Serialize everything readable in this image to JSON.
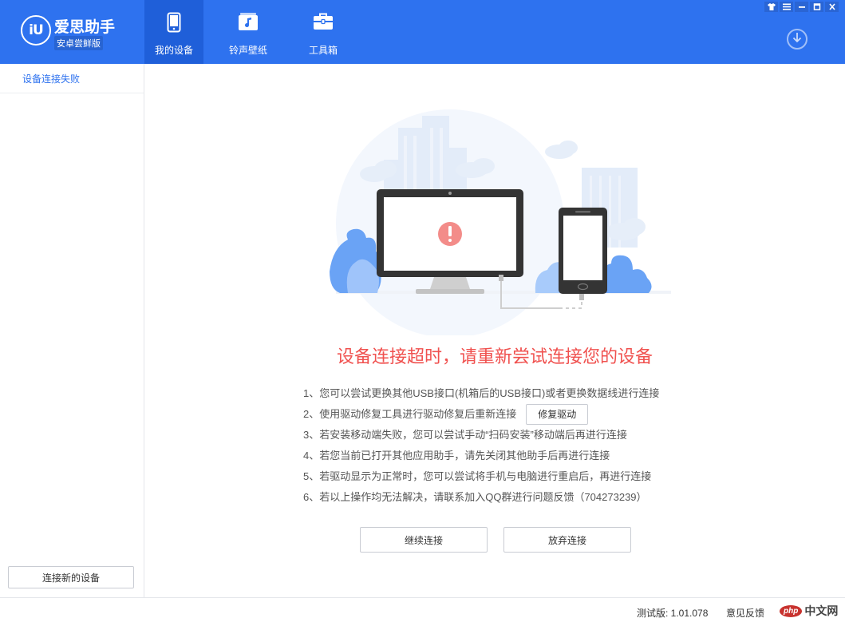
{
  "app": {
    "logo_mark": "iU",
    "name": "爱思助手",
    "edition": "安卓尝鲜版"
  },
  "nav": {
    "tabs": [
      {
        "label": "我的设备",
        "icon": "phone-icon",
        "active": true
      },
      {
        "label": "铃声壁纸",
        "icon": "music-file-icon",
        "active": false
      },
      {
        "label": "工具箱",
        "icon": "toolbox-icon",
        "active": false
      }
    ]
  },
  "window_controls": [
    "shirt-icon",
    "menu-icon",
    "minimize-icon",
    "maximize-icon",
    "close-icon"
  ],
  "sidebar": {
    "items": [
      {
        "label": "设备连接失败"
      }
    ],
    "new_device_button": "连接新的设备"
  },
  "main": {
    "error_title": "设备连接超时，请重新尝试连接您的设备",
    "tips": [
      "1、您可以尝试更换其他USB接口(机箱后的USB接口)或者更换数据线进行连接",
      "2、使用驱动修复工具进行驱动修复后重新连接",
      "3、若安装移动端失败，您可以尝试手动“扫码安装”移动端后再进行连接",
      "4、若您当前已打开其他应用助手，请先关闭其他助手后再进行连接",
      "5、若驱动显示为正常时，您可以尝试将手机与电脑进行重启后，再进行连接",
      "6、若以上操作均无法解决，请联系加入QQ群进行问题反馈（704273239）"
    ],
    "fix_driver_button": "修复驱动",
    "continue_button": "继续连接",
    "abandon_button": "放弃连接"
  },
  "statusbar": {
    "version": "测试版: 1.01.078",
    "feedback": "意见反馈",
    "watermark_logo": "php",
    "watermark_text": "中文网"
  },
  "colors": {
    "header_blue": "#2e72ef",
    "active_tab": "#1f5fd9",
    "error_red": "#f0514f"
  }
}
